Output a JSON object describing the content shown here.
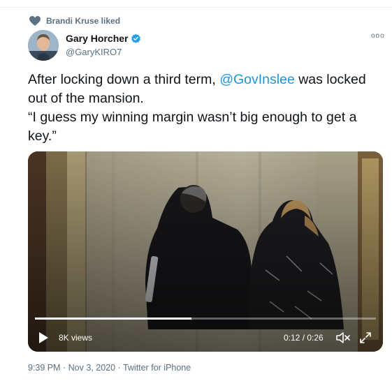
{
  "social_context": {
    "text": "Brandi Kruse liked",
    "icon": "heart-icon"
  },
  "author": {
    "name": "Gary Horcher",
    "handle": "@GaryKIRO7",
    "verified_icon": "verified-badge-icon"
  },
  "more_label": "ooo",
  "tweet": {
    "line1_pre": "After locking down a third term, ",
    "mention": "@GovInslee",
    "line1_post": " was locked out of the mansion.",
    "quote": "“I guess my winning margin wasn’t big enough to get a key.”"
  },
  "video": {
    "views": "8K views",
    "time": "0:12 / 0:26",
    "progress": 0.46,
    "icons": [
      "play-icon",
      "mute-icon",
      "expand-icon"
    ]
  },
  "meta": "9:39 PM · Nov 3, 2020 · Twitter for iPhone",
  "colors": {
    "link": "#1b95e0",
    "muted": "#5b7083",
    "verified": "#1da1f2"
  }
}
